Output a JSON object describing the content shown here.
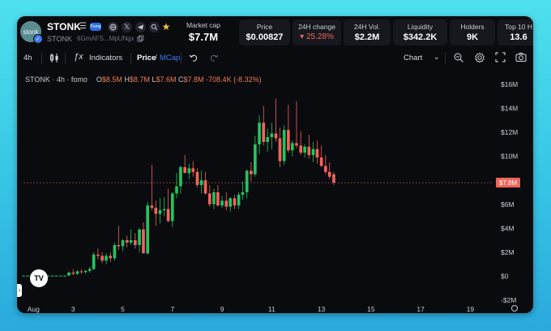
{
  "token": {
    "logo_text": "stonk",
    "symbol": "STONK",
    "sub_symbol": "STONK",
    "address": "6GmAFS...MpUNgx",
    "badge_text": "Pump"
  },
  "stats": {
    "market_cap": {
      "label": "Market cap",
      "value": "$7.7M"
    },
    "price": {
      "label": "Price",
      "value": "$0.00827"
    },
    "change_24h": {
      "label": "24H change",
      "value": "▾ 25.28%"
    },
    "vol_24h": {
      "label": "24H Vol.",
      "value": "$2.2M"
    },
    "liquidity": {
      "label": "Liquidity",
      "value": "$342.2K"
    },
    "holders": {
      "label": "Holders",
      "value": "9K"
    },
    "top10": {
      "label": "Top 10 H",
      "value": "13.6"
    }
  },
  "toolbar": {
    "interval": "4h",
    "indicators": "Indicators",
    "price_label": "Price",
    "sep": "/",
    "mcap_label": "MCap",
    "chart_label": "Chart"
  },
  "legend": {
    "title": "STONK · 4h · fomo",
    "o_key": "O",
    "o_val": "$8.5M",
    "h_key": "H",
    "h_val": "$8.7M",
    "l_key": "L",
    "l_val": "$7.6M",
    "c_key": "C",
    "c_val": "$7.8M",
    "chg": "-708.4K (-8.32%)"
  },
  "tv_logo": "TV",
  "colors": {
    "up": "#22c55e",
    "down": "#f0655a",
    "price_tag": "#f0655a",
    "accent": "#3b7bf0",
    "background": "#0a0b0f"
  },
  "chart_data": {
    "type": "candlestick",
    "title": "",
    "ylabel": "",
    "ylim": [
      -2,
      16
    ],
    "y_ticks": [
      "$16M",
      "$14M",
      "$12M",
      "$10M",
      "$8M",
      "$6M",
      "$4M",
      "$2M",
      "$0",
      "-$2M"
    ],
    "y_tick_values": [
      16,
      14,
      12,
      10,
      8,
      6,
      4,
      2,
      0,
      -2
    ],
    "x_ticks": [
      "Aug",
      "3",
      "5",
      "7",
      "9",
      "11",
      "13",
      "15",
      "17",
      "19"
    ],
    "x_tick_days": [
      1.4,
      3,
      5,
      7,
      9,
      11,
      13,
      15,
      17,
      19
    ],
    "xlim": [
      1.0,
      19.9
    ],
    "current_price_label": "$7.8M",
    "current_price": 7.8,
    "candles": [
      {
        "d": 1.0,
        "o": 0.05,
        "h": 0.06,
        "l": 0.04,
        "c": 0.05
      },
      {
        "d": 1.17,
        "o": 0.05,
        "h": 0.06,
        "l": 0.04,
        "c": 0.05
      },
      {
        "d": 1.33,
        "o": 0.05,
        "h": 0.06,
        "l": 0.04,
        "c": 0.05
      },
      {
        "d": 1.5,
        "o": 0.05,
        "h": 0.06,
        "l": 0.04,
        "c": 0.05
      },
      {
        "d": 1.67,
        "o": 0.05,
        "h": 0.06,
        "l": 0.04,
        "c": 0.05
      },
      {
        "d": 1.83,
        "o": 0.05,
        "h": 0.06,
        "l": 0.04,
        "c": 0.05
      },
      {
        "d": 2.0,
        "o": 0.05,
        "h": 0.06,
        "l": 0.04,
        "c": 0.05
      },
      {
        "d": 2.17,
        "o": 0.05,
        "h": 0.06,
        "l": 0.04,
        "c": 0.05
      },
      {
        "d": 2.33,
        "o": 0.05,
        "h": 0.06,
        "l": 0.04,
        "c": 0.05
      },
      {
        "d": 2.5,
        "o": 0.05,
        "h": 0.06,
        "l": 0.04,
        "c": 0.05
      },
      {
        "d": 2.67,
        "o": 0.05,
        "h": 0.06,
        "l": 0.04,
        "c": 0.05
      },
      {
        "d": 2.83,
        "o": 0.05,
        "h": 0.4,
        "l": 0.04,
        "c": 0.3
      },
      {
        "d": 3.0,
        "o": 0.3,
        "h": 0.6,
        "l": 0.1,
        "c": 0.2
      },
      {
        "d": 3.17,
        "o": 0.2,
        "h": 0.5,
        "l": 0.1,
        "c": 0.4
      },
      {
        "d": 3.33,
        "o": 0.4,
        "h": 0.6,
        "l": 0.2,
        "c": 0.35
      },
      {
        "d": 3.5,
        "o": 0.35,
        "h": 0.5,
        "l": 0.2,
        "c": 0.45
      },
      {
        "d": 3.67,
        "o": 0.45,
        "h": 0.8,
        "l": 0.3,
        "c": 0.6
      },
      {
        "d": 3.83,
        "o": 0.6,
        "h": 2.0,
        "l": 0.5,
        "c": 1.8
      },
      {
        "d": 4.0,
        "o": 1.8,
        "h": 2.3,
        "l": 1.4,
        "c": 1.7
      },
      {
        "d": 4.17,
        "o": 1.7,
        "h": 2.0,
        "l": 1.1,
        "c": 1.3
      },
      {
        "d": 4.33,
        "o": 1.3,
        "h": 1.9,
        "l": 1.0,
        "c": 1.7
      },
      {
        "d": 4.5,
        "o": 1.7,
        "h": 2.0,
        "l": 1.2,
        "c": 1.5
      },
      {
        "d": 4.67,
        "o": 1.5,
        "h": 2.8,
        "l": 1.3,
        "c": 2.6
      },
      {
        "d": 4.83,
        "o": 2.6,
        "h": 4.2,
        "l": 2.2,
        "c": 2.5
      },
      {
        "d": 5.0,
        "o": 2.5,
        "h": 3.1,
        "l": 2.1,
        "c": 3.0
      },
      {
        "d": 5.17,
        "o": 3.0,
        "h": 3.4,
        "l": 2.4,
        "c": 2.8
      },
      {
        "d": 5.33,
        "o": 2.8,
        "h": 3.9,
        "l": 2.6,
        "c": 3.0
      },
      {
        "d": 5.5,
        "o": 3.0,
        "h": 3.6,
        "l": 2.3,
        "c": 2.6
      },
      {
        "d": 5.67,
        "o": 2.6,
        "h": 4.0,
        "l": 2.0,
        "c": 3.9
      },
      {
        "d": 5.83,
        "o": 3.9,
        "h": 4.5,
        "l": 2.2,
        "c": 1.9
      },
      {
        "d": 6.0,
        "o": 1.9,
        "h": 6.2,
        "l": 1.8,
        "c": 5.9
      },
      {
        "d": 6.17,
        "o": 5.9,
        "h": 9.3,
        "l": 5.5,
        "c": 5.7
      },
      {
        "d": 6.33,
        "o": 5.7,
        "h": 6.3,
        "l": 4.2,
        "c": 5.2
      },
      {
        "d": 6.5,
        "o": 5.2,
        "h": 6.5,
        "l": 4.4,
        "c": 5.5
      },
      {
        "d": 6.67,
        "o": 5.5,
        "h": 6.6,
        "l": 5.0,
        "c": 5.6
      },
      {
        "d": 6.83,
        "o": 5.6,
        "h": 7.3,
        "l": 4.5,
        "c": 4.6
      },
      {
        "d": 7.0,
        "o": 4.6,
        "h": 7.0,
        "l": 4.1,
        "c": 6.9
      },
      {
        "d": 7.17,
        "o": 6.9,
        "h": 8.6,
        "l": 6.5,
        "c": 7.5
      },
      {
        "d": 7.33,
        "o": 7.5,
        "h": 9.2,
        "l": 6.9,
        "c": 9.1
      },
      {
        "d": 7.5,
        "o": 9.1,
        "h": 10.1,
        "l": 8.6,
        "c": 8.6
      },
      {
        "d": 7.67,
        "o": 8.6,
        "h": 9.4,
        "l": 8.1,
        "c": 9.0
      },
      {
        "d": 7.83,
        "o": 9.0,
        "h": 9.6,
        "l": 8.3,
        "c": 8.7
      },
      {
        "d": 8.0,
        "o": 8.7,
        "h": 9.0,
        "l": 7.4,
        "c": 7.6
      },
      {
        "d": 8.17,
        "o": 7.6,
        "h": 8.8,
        "l": 6.9,
        "c": 8.0
      },
      {
        "d": 8.33,
        "o": 8.0,
        "h": 8.7,
        "l": 6.8,
        "c": 6.9
      },
      {
        "d": 8.5,
        "o": 6.9,
        "h": 7.6,
        "l": 5.8,
        "c": 6.0
      },
      {
        "d": 8.67,
        "o": 6.0,
        "h": 7.3,
        "l": 5.6,
        "c": 7.0
      },
      {
        "d": 8.83,
        "o": 7.0,
        "h": 7.6,
        "l": 5.8,
        "c": 5.9
      },
      {
        "d": 9.0,
        "o": 5.9,
        "h": 6.7,
        "l": 5.7,
        "c": 6.3
      },
      {
        "d": 9.17,
        "o": 6.3,
        "h": 7.0,
        "l": 5.5,
        "c": 5.8
      },
      {
        "d": 9.33,
        "o": 5.8,
        "h": 6.6,
        "l": 5.4,
        "c": 6.5
      },
      {
        "d": 9.5,
        "o": 6.5,
        "h": 6.8,
        "l": 5.6,
        "c": 5.9
      },
      {
        "d": 9.67,
        "o": 5.9,
        "h": 7.0,
        "l": 5.6,
        "c": 6.8
      },
      {
        "d": 9.83,
        "o": 6.8,
        "h": 7.9,
        "l": 6.4,
        "c": 7.0
      },
      {
        "d": 10.0,
        "o": 7.0,
        "h": 8.9,
        "l": 6.5,
        "c": 8.8
      },
      {
        "d": 10.17,
        "o": 8.8,
        "h": 9.5,
        "l": 7.9,
        "c": 8.5
      },
      {
        "d": 10.33,
        "o": 8.5,
        "h": 11.7,
        "l": 8.3,
        "c": 11.0
      },
      {
        "d": 10.5,
        "o": 11.0,
        "h": 13.4,
        "l": 10.2,
        "c": 12.8
      },
      {
        "d": 10.67,
        "o": 12.8,
        "h": 14.2,
        "l": 10.9,
        "c": 11.2
      },
      {
        "d": 10.83,
        "o": 11.2,
        "h": 12.3,
        "l": 10.4,
        "c": 11.6
      },
      {
        "d": 11.0,
        "o": 11.6,
        "h": 12.8,
        "l": 10.6,
        "c": 11.9
      },
      {
        "d": 11.17,
        "o": 11.9,
        "h": 14.8,
        "l": 11.2,
        "c": 11.5
      },
      {
        "d": 11.33,
        "o": 11.5,
        "h": 12.4,
        "l": 9.1,
        "c": 9.6
      },
      {
        "d": 11.5,
        "o": 9.6,
        "h": 12.6,
        "l": 9.3,
        "c": 12.2
      },
      {
        "d": 11.67,
        "o": 12.2,
        "h": 14.3,
        "l": 10.3,
        "c": 10.5
      },
      {
        "d": 11.83,
        "o": 10.5,
        "h": 11.3,
        "l": 10.0,
        "c": 11.1
      },
      {
        "d": 12.0,
        "o": 11.1,
        "h": 14.6,
        "l": 10.7,
        "c": 10.9
      },
      {
        "d": 12.17,
        "o": 10.9,
        "h": 12.1,
        "l": 10.1,
        "c": 10.3
      },
      {
        "d": 12.33,
        "o": 10.3,
        "h": 11.0,
        "l": 9.9,
        "c": 10.8
      },
      {
        "d": 12.5,
        "o": 10.8,
        "h": 11.8,
        "l": 9.8,
        "c": 10.1
      },
      {
        "d": 12.67,
        "o": 10.1,
        "h": 11.2,
        "l": 9.5,
        "c": 10.6
      },
      {
        "d": 12.83,
        "o": 10.6,
        "h": 11.3,
        "l": 9.4,
        "c": 9.9
      },
      {
        "d": 13.0,
        "o": 9.9,
        "h": 10.9,
        "l": 9.1,
        "c": 9.2
      },
      {
        "d": 13.17,
        "o": 9.2,
        "h": 10.1,
        "l": 8.5,
        "c": 8.7
      },
      {
        "d": 13.33,
        "o": 8.7,
        "h": 9.5,
        "l": 8.1,
        "c": 8.3
      },
      {
        "d": 13.5,
        "o": 8.5,
        "h": 8.7,
        "l": 7.6,
        "c": 7.8
      }
    ]
  }
}
